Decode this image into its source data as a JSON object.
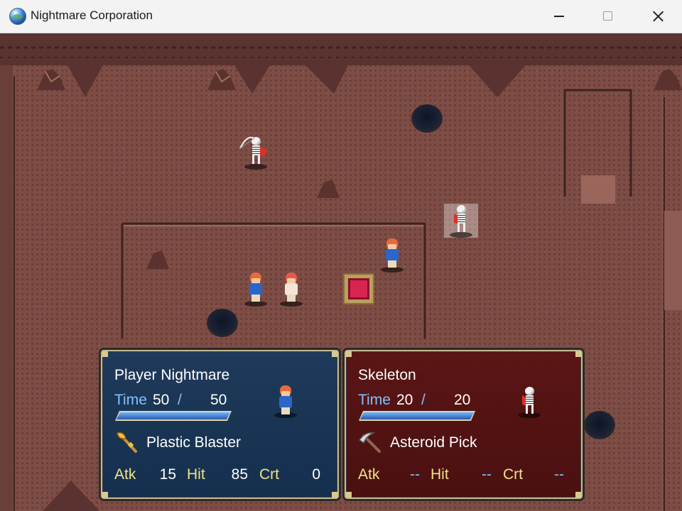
{
  "window": {
    "title": "Nightmare Corporation",
    "controls": [
      "minimize",
      "maximize",
      "close"
    ]
  },
  "map": {
    "theme_colors": {
      "ground": "#7d4d45",
      "player_panel": "#1f3a5a",
      "enemy_panel": "#5b1515"
    },
    "units": [
      {
        "name": "skeleton-archer",
        "team": "enemy"
      },
      {
        "name": "skeleton-targeted",
        "team": "enemy"
      },
      {
        "name": "blue-hero",
        "team": "player"
      },
      {
        "name": "ally-1",
        "team": "player"
      },
      {
        "name": "ally-2",
        "team": "player"
      }
    ]
  },
  "player_panel": {
    "name": "Player Nightmare",
    "time_label": "Time",
    "time_current": "50",
    "slash": "/",
    "time_max": "50",
    "time_fraction": 1.0,
    "weapon_icon": "axe-icon",
    "weapon": "Plastic Blaster",
    "stats": {
      "atk_label": "Atk",
      "atk": "15",
      "hit_label": "Hit",
      "hit": "85",
      "crt_label": "Crt",
      "crt": "0"
    }
  },
  "enemy_panel": {
    "name": "Skeleton",
    "time_label": "Time",
    "time_current": "20",
    "slash": "/",
    "time_max": "20",
    "time_fraction": 1.0,
    "weapon_icon": "pickaxe-icon",
    "weapon": "Asteroid Pick",
    "stats": {
      "atk_label": "Atk",
      "atk": "--",
      "hit_label": "Hit",
      "hit": "--",
      "crt_label": "Crt",
      "crt": "--"
    }
  }
}
